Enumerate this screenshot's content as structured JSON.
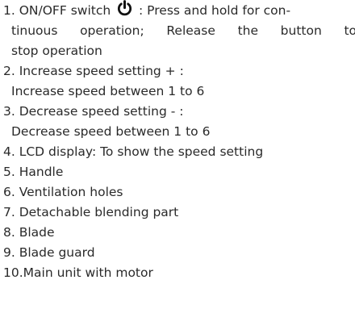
{
  "items": [
    {
      "line1_start": "1. ON/OFF switch ",
      "icon": "power-icon",
      "line1_end": " : Press and hold for con-",
      "line2": "tinuous operation; Release the button to",
      "line3": "stop operation"
    },
    {
      "line1": "2. Increase speed setting  + :",
      "line2": "Increase speed between 1 to 6"
    },
    {
      "line1": "3. Decrease speed setting  - :",
      "line2": "Decrease speed between 1 to 6"
    },
    {
      "line1": "4. LCD display: To show the speed setting"
    },
    {
      "line1": "5. Handle"
    },
    {
      "line1": "6. Ventilation holes"
    },
    {
      "line1": "7. Detachable blending part"
    },
    {
      "line1": "8. Blade"
    },
    {
      "line1": "9. Blade guard"
    },
    {
      "line1": "10.Main unit with motor"
    }
  ]
}
